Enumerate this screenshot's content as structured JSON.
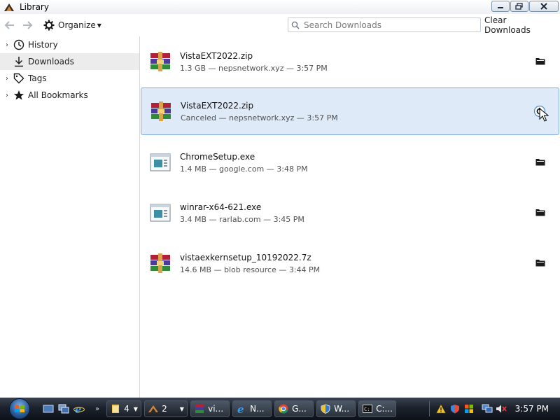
{
  "window": {
    "title": "Library"
  },
  "toolbar": {
    "organize_label": "Organize",
    "search_placeholder": "Search Downloads",
    "clear_label": "Clear Downloads"
  },
  "sidebar": {
    "items": [
      {
        "label": "History",
        "icon": "clock-icon",
        "expandable": true
      },
      {
        "label": "Downloads",
        "icon": "download-arrow-icon",
        "expandable": false,
        "active": true
      },
      {
        "label": "Tags",
        "icon": "tag-icon",
        "expandable": true
      },
      {
        "label": "All Bookmarks",
        "icon": "star-icon",
        "expandable": true
      }
    ]
  },
  "downloads": [
    {
      "name": "VistaEXT2022.zip",
      "status": "1.3 GB — nepsnetwork.xyz — 3:57 PM",
      "icon": "winrar-archive-icon",
      "action_icon": "folder-icon",
      "selected": false
    },
    {
      "name": "VistaEXT2022.zip",
      "status": "Canceled — nepsnetwork.xyz — 3:57 PM",
      "icon": "winrar-archive-icon",
      "action_icon": "retry-icon",
      "selected": true
    },
    {
      "name": "ChromeSetup.exe",
      "status": "1.4 MB — google.com — 3:48 PM",
      "icon": "executable-icon",
      "action_icon": "folder-icon",
      "selected": false
    },
    {
      "name": "winrar-x64-621.exe",
      "status": "3.4 MB — rarlab.com — 3:45 PM",
      "icon": "executable-icon",
      "action_icon": "folder-icon",
      "selected": false
    },
    {
      "name": "vistaexkernsetup_10192022.7z",
      "status": "14.6 MB — blob resource — 3:44 PM",
      "icon": "winrar-archive-icon",
      "action_icon": "folder-icon",
      "selected": false
    }
  ],
  "taskbar": {
    "buttons": [
      {
        "count": "4",
        "icon": "folder-icon",
        "label": ""
      },
      {
        "count": "2",
        "icon": "firefox-icon",
        "label": ""
      },
      {
        "label": "vi...",
        "icon": "winrar-icon"
      },
      {
        "label": "N...",
        "icon": "ie-icon"
      },
      {
        "label": "G...",
        "icon": "chrome-icon"
      },
      {
        "label": "W...",
        "icon": "shield-icon"
      },
      {
        "label": "C:...",
        "icon": "cmd-icon"
      }
    ],
    "clock": "3:57 PM"
  },
  "colors": {
    "selection_bg": "#dfeaf8",
    "selection_border": "#84acdd",
    "taskbar_bg": "#1c222c"
  }
}
